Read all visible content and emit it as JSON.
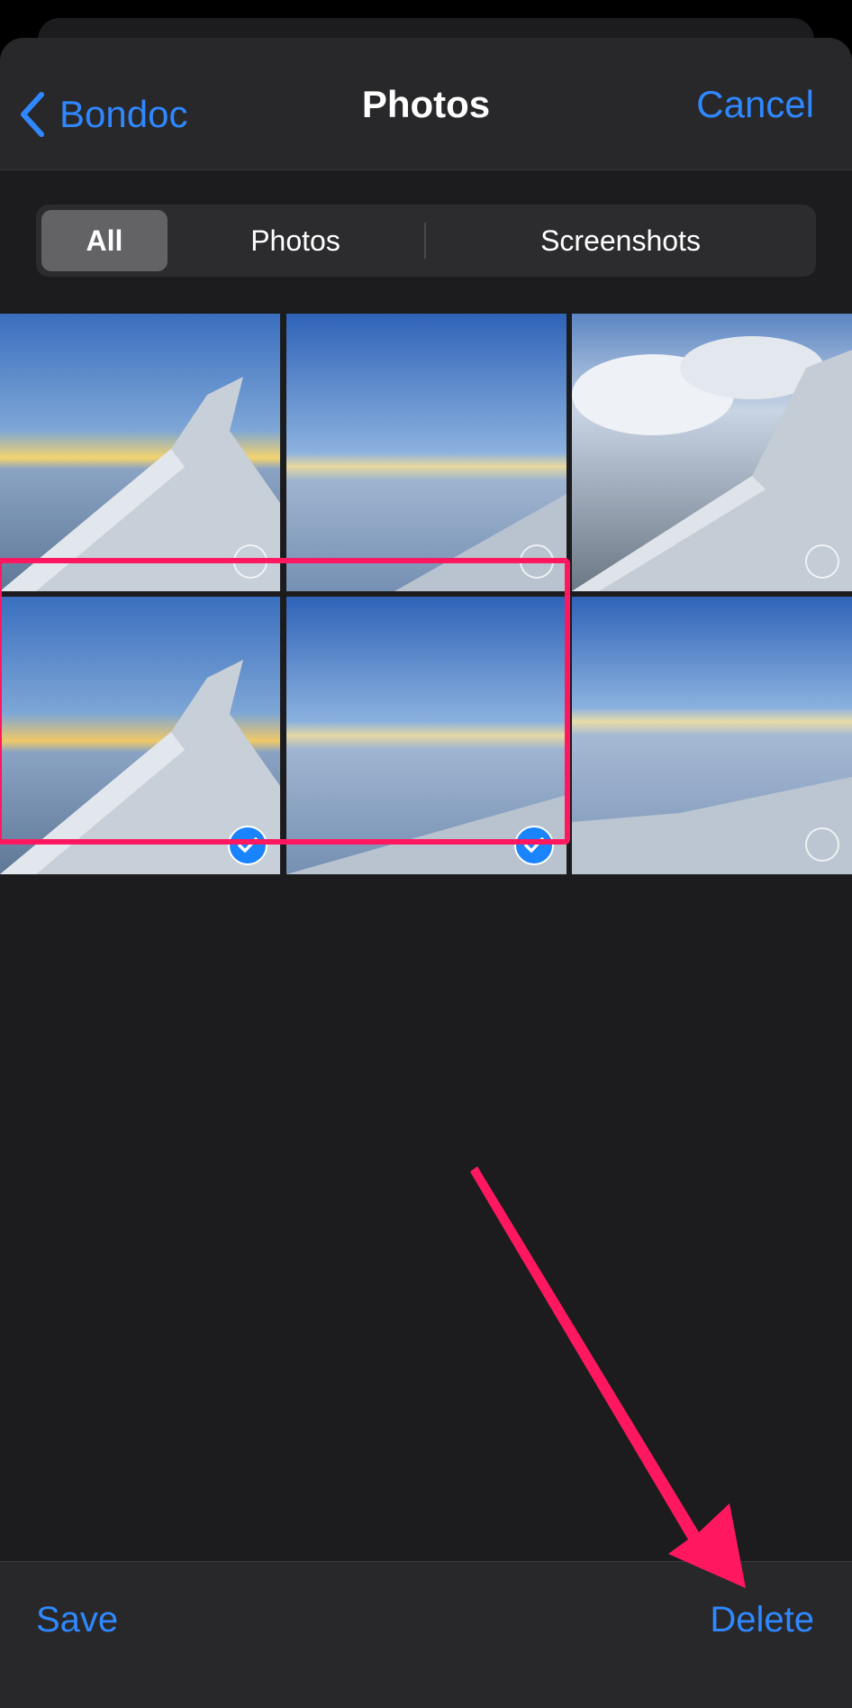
{
  "nav": {
    "back_label": "Bondoc",
    "title": "Photos",
    "cancel_label": "Cancel"
  },
  "segments": [
    {
      "label": "All",
      "active": true
    },
    {
      "label": "Photos",
      "active": false
    },
    {
      "label": "Screenshots",
      "active": false
    }
  ],
  "photos": [
    {
      "subject": "airplane wing at sunset over clouds",
      "selected": false
    },
    {
      "subject": "sky over cloud layer",
      "selected": false
    },
    {
      "subject": "Ryanair wing with clouds",
      "selected": false
    },
    {
      "subject": "airplane wing at sunset over clouds",
      "selected": true
    },
    {
      "subject": "sky over cloud layer with wing edge",
      "selected": true
    },
    {
      "subject": "sky over clouds with wing",
      "selected": false
    }
  ],
  "toolbar": {
    "save_label": "Save",
    "delete_label": "Delete"
  },
  "colors": {
    "accent": "#2f88ff",
    "annotation": "#ff1860",
    "selected_check": "#1a84ff",
    "background": "#1c1c1e"
  },
  "icons": {
    "back": "chevron-left-icon",
    "selected": "checkmark-circle-icon",
    "unselected": "empty-circle-icon"
  }
}
